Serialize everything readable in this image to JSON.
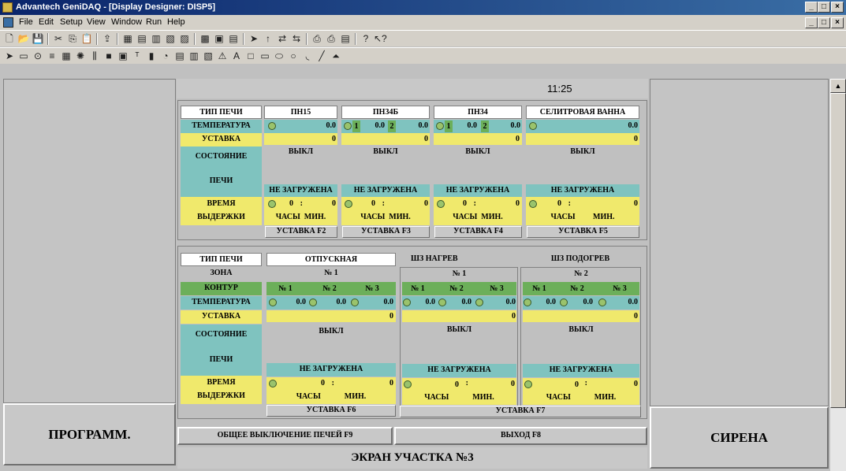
{
  "window": {
    "title": "Advantech GeniDAQ - [Display Designer: DISP5]",
    "min": "_",
    "restore": "□",
    "close": "×"
  },
  "menu": [
    "File",
    "Edit",
    "Setup",
    "View",
    "Window",
    "Run",
    "Help"
  ],
  "clock": "11:25",
  "left_button": "ПРОГРАММ.",
  "right_button": "СИРЕНА",
  "footer": {
    "shutdown": "ОБЩЕЕ ВЫКЛЮЧЕНИЕ ПЕЧЕЙ F9",
    "exit": "ВЫХОД F8",
    "screen": "ЭКРАН УЧАСТКА №3"
  },
  "top": {
    "labels": {
      "type": "ТИП ПЕЧИ",
      "temp": "ТЕМПЕРАТУРА",
      "setpoint": "УСТАВКА",
      "state1": "СОСТОЯНИЕ",
      "state2": "ПЕЧИ",
      "time1": "ВРЕМЯ",
      "time2": "ВЫДЕРЖКИ"
    },
    "furnaces": [
      {
        "name": "ПН15",
        "temp": "0.0",
        "set": "0",
        "state": "ВЫКЛ",
        "load": "НЕ ЗАГРУЖЕНА",
        "hours": "0",
        "mins": "0",
        "hl": "ЧАСЫ",
        "ml": "МИН.",
        "btn": "УСТАВКА F2"
      },
      {
        "name": "ПН34Б",
        "z1": "1",
        "t1": "0.0",
        "z2": "2",
        "t2": "0.0",
        "set": "0",
        "state": "ВЫКЛ",
        "load": "НЕ ЗАГРУЖЕНА",
        "hours": "0",
        "mins": "0",
        "hl": "ЧАСЫ",
        "ml": "МИН.",
        "btn": "УСТАВКА F3"
      },
      {
        "name": "ПН34",
        "z1": "1",
        "t1": "0.0",
        "z2": "2",
        "t2": "0.0",
        "set": "0",
        "state": "ВЫКЛ",
        "load": "НЕ ЗАГРУЖЕНА",
        "hours": "0",
        "mins": "0",
        "hl": "ЧАСЫ",
        "ml": "МИН.",
        "btn": "УСТАВКА F4"
      },
      {
        "name": "СЕЛИТРОВАЯ ВАННА",
        "temp": "0.0",
        "set": "0",
        "state": "ВЫКЛ",
        "load": "НЕ ЗАГРУЖЕНА",
        "hours": "0",
        "mins": "0",
        "hl": "ЧАСЫ",
        "ml": "МИН.",
        "btn": "УСТАВКА F5"
      }
    ]
  },
  "bottom": {
    "labels": {
      "type": "ТИП ПЕЧИ",
      "zone": "ЗОНА",
      "circuit": "КОНТУР",
      "temp": "ТЕМПЕРАТУРА",
      "setpoint": "УСТАВКА",
      "state1": "СОСТОЯНИЕ",
      "state2": "ПЕЧИ",
      "time1": "ВРЕМЯ",
      "time2": "ВЫДЕРЖКИ"
    },
    "colon": ":",
    "zero": "0",
    "furnaces": [
      {
        "name": "ОТПУСКНАЯ",
        "zone": "№ 1",
        "c": [
          "№ 1",
          "№ 2",
          "№ 3"
        ],
        "t": [
          "0.0",
          "0.0",
          "0.0"
        ],
        "set": "0",
        "state": "ВЫКЛ",
        "load": "НЕ ЗАГРУЖЕНА",
        "hours": "0",
        "mins": "0",
        "hl": "ЧАСЫ",
        "ml": "МИН.",
        "btn": "УСТАВКА F6"
      },
      {
        "name": "ШЗ НАГРЕВ",
        "zone": "№ 1",
        "c": [
          "№ 1",
          "№ 2",
          "№ 3"
        ],
        "t": [
          "0.0",
          "0.0",
          "0.0"
        ],
        "set": "0",
        "state": "ВЫКЛ",
        "load": "НЕ ЗАГРУЖЕНА",
        "hours": "0",
        "mins": "0",
        "hl": "ЧАСЫ",
        "ml": "МИН."
      },
      {
        "name": "ШЗ ПОДОГРЕВ",
        "zone": "№ 2",
        "c": [
          "№ 1",
          "№ 2",
          "№ 3"
        ],
        "t": [
          "0.0",
          "0.0",
          "0.0"
        ],
        "set": "0",
        "state": "ВЫКЛ",
        "load": "НЕ ЗАГРУЖЕНА",
        "hours": "0",
        "mins": "0",
        "hl": "ЧАСЫ",
        "ml": "МИН."
      }
    ],
    "btn7": "УСТАВКА F7"
  }
}
